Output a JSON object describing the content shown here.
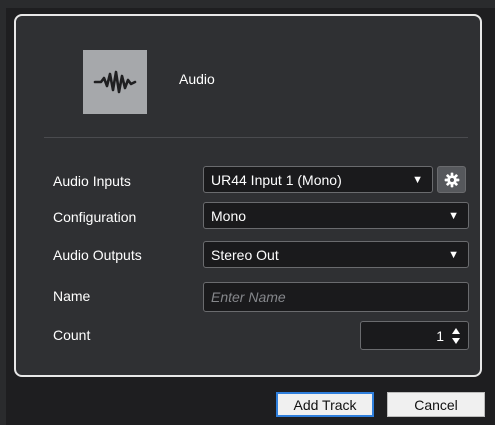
{
  "dialog": {
    "track_type_label": "Audio",
    "track_icon": "audio-waveform-icon"
  },
  "fields": {
    "audio_inputs": {
      "label": "Audio Inputs",
      "value": "UR44 Input 1 (Mono)",
      "settings_icon": "gear-icon"
    },
    "configuration": {
      "label": "Configuration",
      "value": "Mono"
    },
    "audio_outputs": {
      "label": "Audio Outputs",
      "value": "Stereo Out"
    },
    "name": {
      "label": "Name",
      "value": "",
      "placeholder": "Enter Name"
    },
    "count": {
      "label": "Count",
      "value": "1"
    }
  },
  "buttons": {
    "add_track": "Add Track",
    "cancel": "Cancel"
  },
  "colors": {
    "panel_background": "#2f3033",
    "panel_border": "#e8e8e8",
    "icon_tile": "#a6a8ab",
    "primary_focus": "#2f7fdc"
  }
}
